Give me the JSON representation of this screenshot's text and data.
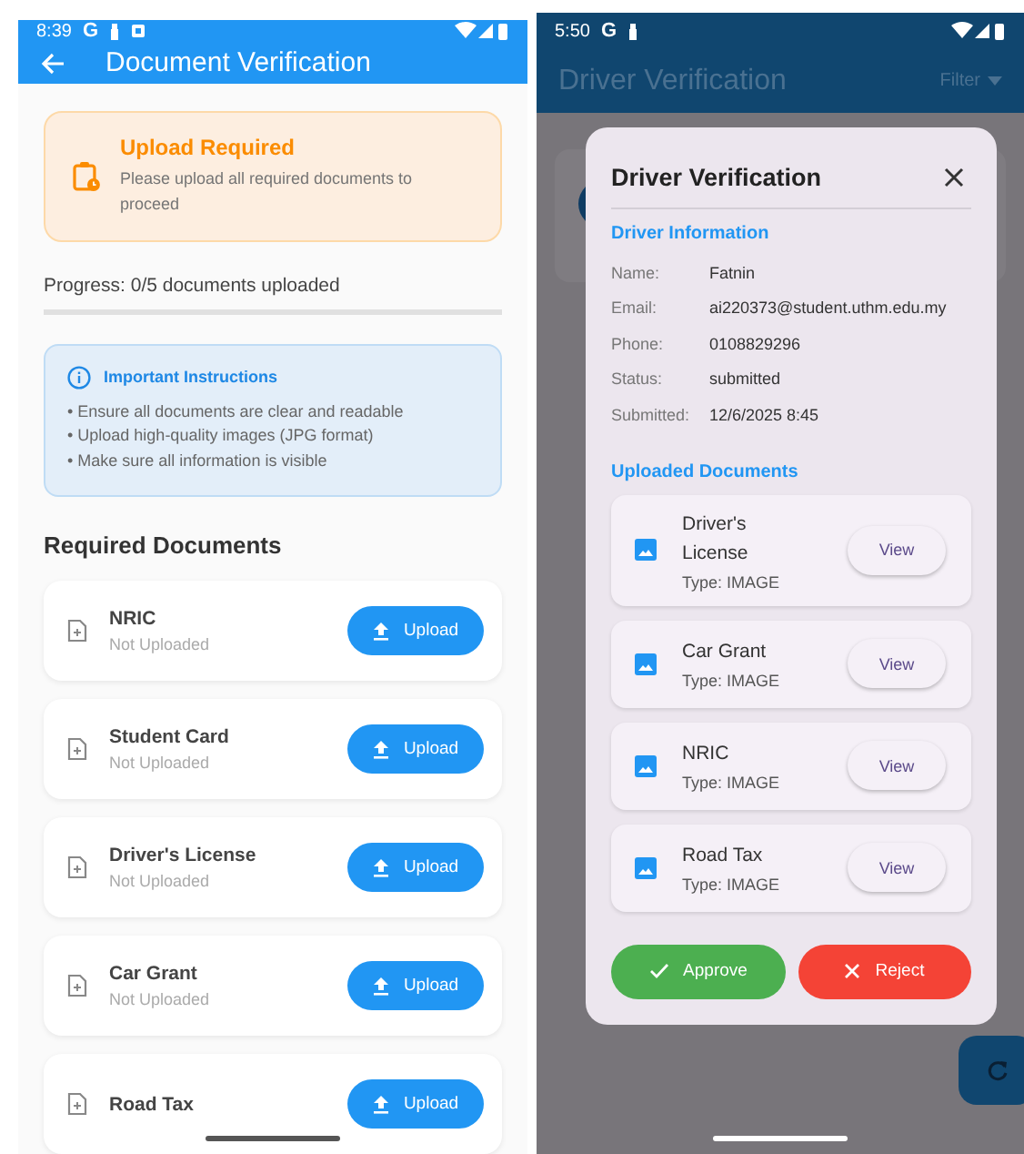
{
  "upload_screen": {
    "status_bar": {
      "time": "8:39",
      "carrier": "G"
    },
    "app_bar": {
      "title": "Document Verification"
    },
    "notice": {
      "title": "Upload Required",
      "message": "Please upload all required documents to proceed"
    },
    "progress": {
      "label": "Progress: 0/5 documents uploaded",
      "level": 0
    },
    "instructions": {
      "title": "Important Instructions",
      "items": [
        "• Ensure all documents are clear and readable",
        "• Upload high-quality images (JPG format)",
        "• Make sure all information is visible"
      ]
    },
    "section_title": "Required Documents",
    "documents": [
      {
        "name": "NRIC",
        "status": "Not Uploaded",
        "action": "Upload"
      },
      {
        "name": "Student Card",
        "status": "Not Uploaded",
        "action": "Upload"
      },
      {
        "name": "Driver's License",
        "status": "Not Uploaded",
        "action": "Upload"
      },
      {
        "name": "Car Grant",
        "status": "Not Uploaded",
        "action": "Upload"
      },
      {
        "name": "Road Tax",
        "action": "Upload"
      }
    ]
  },
  "admin_screen": {
    "status_bar": {
      "time": "5:50",
      "carrier": "G"
    },
    "app_bar": {
      "title": "Driver Verification",
      "filter": "Filter"
    },
    "dialog": {
      "title": "Driver Verification",
      "info_title": "Driver Information",
      "fields": [
        {
          "label": "Name:",
          "value": "Fatnin"
        },
        {
          "label": "Email:",
          "value": "ai220373@student.uthm.edu.my"
        },
        {
          "label": "Phone:",
          "value": "0108829296"
        },
        {
          "label": "Status:",
          "value": "submitted"
        },
        {
          "label": "Submitted:",
          "value": "12/6/2025 8:45"
        }
      ],
      "documents_title": "Uploaded Documents",
      "documents": [
        {
          "name": "Driver's License",
          "type": "Type: IMAGE",
          "action": "View"
        },
        {
          "name": "Car Grant",
          "type": "Type: IMAGE",
          "action": "View"
        },
        {
          "name": "NRIC",
          "type": "Type: IMAGE",
          "action": "View"
        },
        {
          "name": "Road Tax",
          "type": "Type: IMAGE",
          "action": "View"
        }
      ],
      "approve": "Approve",
      "reject": "Reject"
    }
  }
}
